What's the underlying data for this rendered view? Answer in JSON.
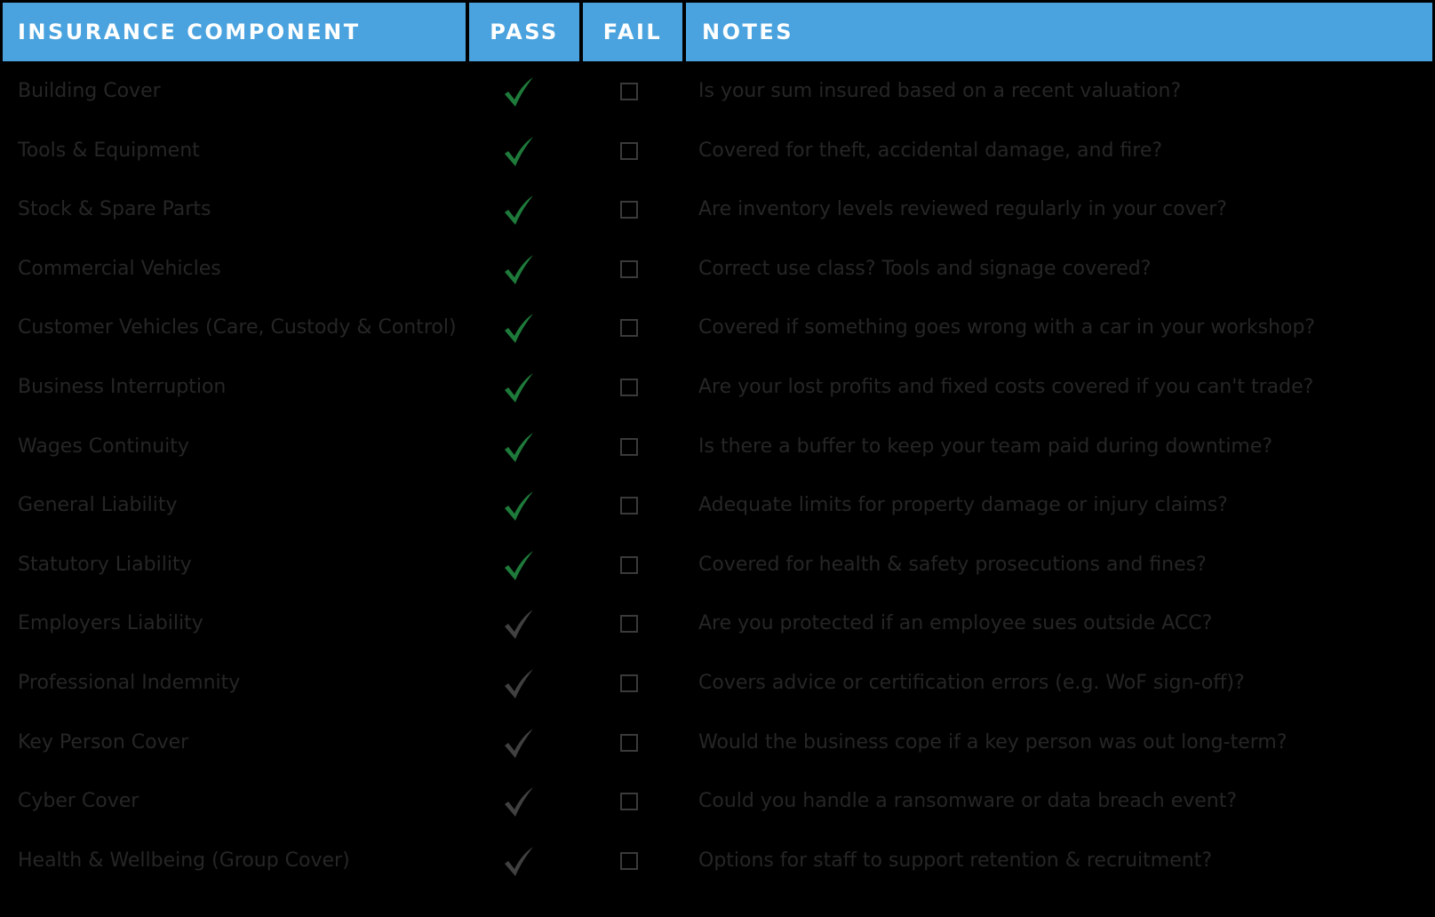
{
  "header": {
    "component": "INSURANCE COMPONENT",
    "pass": "PASS",
    "fail": "FAIL",
    "notes": "NOTES"
  },
  "colors": {
    "header_bg": "#4aa3de",
    "header_text": "#ffffff",
    "background": "#000000",
    "row_text": "#262626",
    "check_green": "#1e7a3a",
    "check_grey": "#404040",
    "checkbox_border": "#3a3a3a"
  },
  "rows": [
    {
      "component": "Building Cover",
      "pass": "check-green",
      "fail": "unchecked",
      "notes": "Is your sum insured based on a recent valuation?"
    },
    {
      "component": "Tools & Equipment",
      "pass": "check-green",
      "fail": "unchecked",
      "notes": "Covered for theft, accidental damage, and fire?"
    },
    {
      "component": "Stock & Spare Parts",
      "pass": "check-green",
      "fail": "unchecked",
      "notes": "Are inventory levels reviewed regularly in your cover?"
    },
    {
      "component": "Commercial Vehicles",
      "pass": "check-green",
      "fail": "unchecked",
      "notes": "Correct use class? Tools and signage covered?"
    },
    {
      "component": "Customer Vehicles (Care, Custody & Control)",
      "pass": "check-green",
      "fail": "unchecked",
      "notes": "Covered if something goes wrong with a car in your workshop?"
    },
    {
      "component": "Business Interruption",
      "pass": "check-green",
      "fail": "unchecked",
      "notes": "Are your lost profits and fixed costs covered if you can't trade?"
    },
    {
      "component": "Wages Continuity",
      "pass": "check-green",
      "fail": "unchecked",
      "notes": "Is there a buffer to keep your team paid during downtime?"
    },
    {
      "component": "General Liability",
      "pass": "check-green",
      "fail": "unchecked",
      "notes": "Adequate limits for property damage or injury claims?"
    },
    {
      "component": "Statutory Liability",
      "pass": "check-green",
      "fail": "unchecked",
      "notes": "Covered for health & safety prosecutions and fines?"
    },
    {
      "component": "Employers Liability",
      "pass": "check-grey",
      "fail": "unchecked",
      "notes": "Are you protected if an employee sues outside ACC?"
    },
    {
      "component": "Professional Indemnity",
      "pass": "check-grey",
      "fail": "unchecked",
      "notes": "Covers advice or certification errors (e.g. WoF sign-off)?"
    },
    {
      "component": "Key Person Cover",
      "pass": "check-grey",
      "fail": "unchecked",
      "notes": "Would the business cope if a key person was out long-term?"
    },
    {
      "component": "Cyber Cover",
      "pass": "check-grey",
      "fail": "unchecked",
      "notes": "Could you handle a ransomware or data breach event?"
    },
    {
      "component": "Health & Wellbeing (Group Cover)",
      "pass": "check-grey",
      "fail": "unchecked",
      "notes": "Options for staff to support retention & recruitment?"
    }
  ]
}
